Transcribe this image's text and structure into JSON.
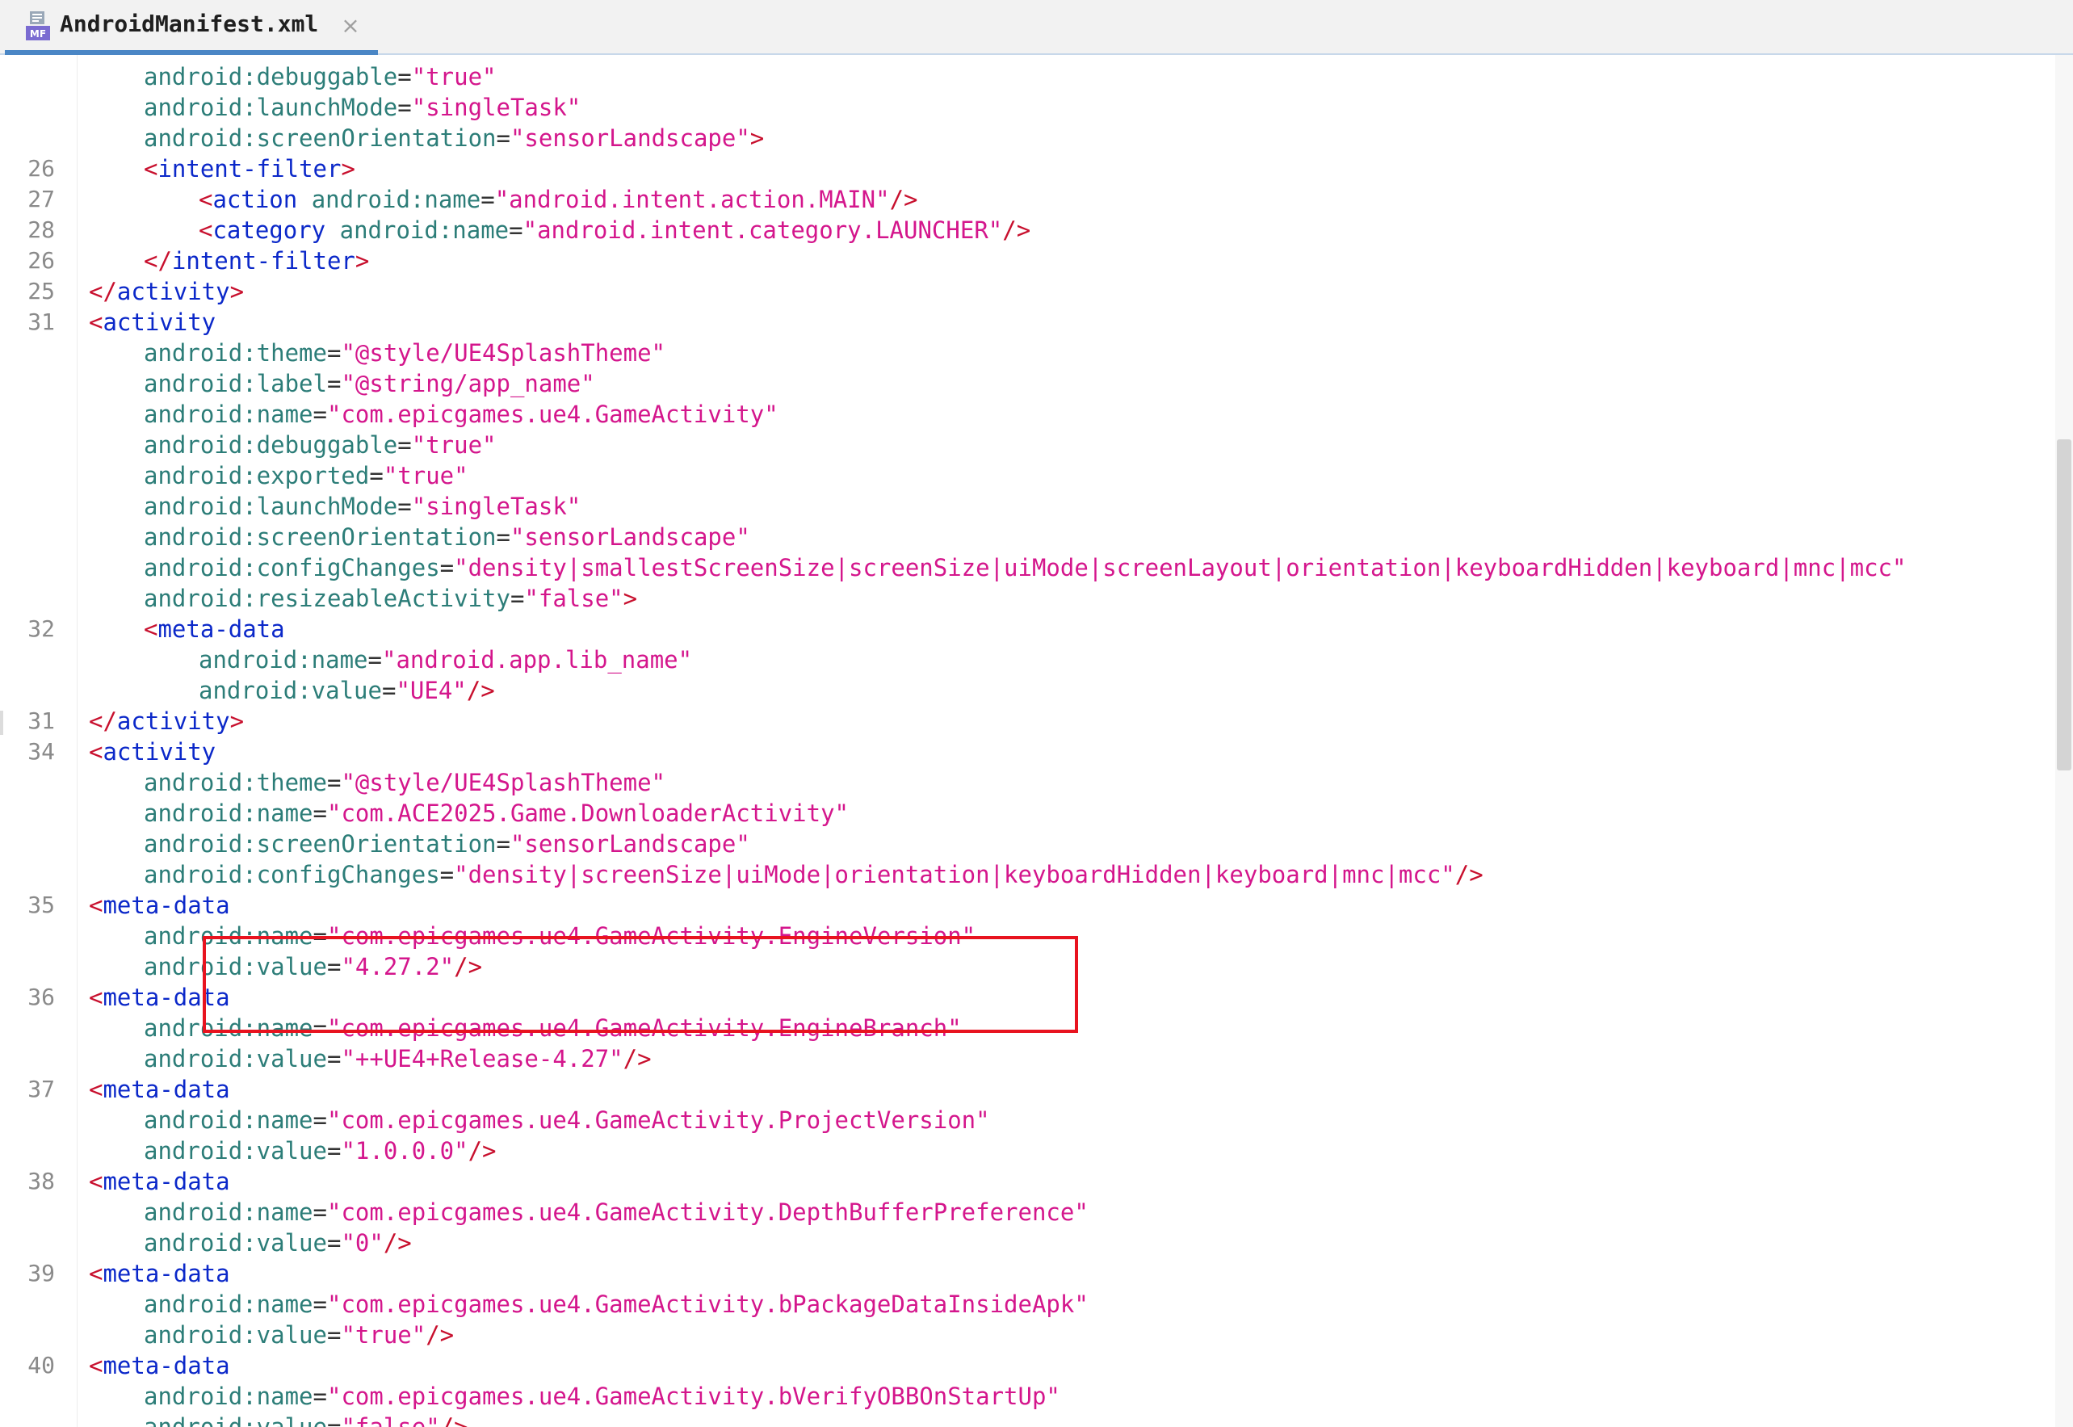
{
  "tab": {
    "title": "AndroidManifest.xml",
    "icon": "manifest-file-icon",
    "icon_label": "MF",
    "close_icon": "close-icon",
    "close_glyph": "×"
  },
  "colors": {
    "tag": "#0b28c9",
    "bracket": "#c8102e",
    "attribute": "#2c7d78",
    "string": "#d4168c",
    "line_number": "#8a8a8a",
    "highlight_border": "#e8131f"
  },
  "editor": {
    "highlighted_block": "meta-data EngineVersion",
    "lines": [
      {
        "num": "",
        "indent": 2,
        "tokens": [
          [
            "a",
            "android:debuggable"
          ],
          [
            "e",
            "="
          ],
          [
            "s",
            "\"true\""
          ]
        ]
      },
      {
        "num": "",
        "indent": 2,
        "tokens": [
          [
            "a",
            "android:launchMode"
          ],
          [
            "e",
            "="
          ],
          [
            "s",
            "\"singleTask\""
          ]
        ]
      },
      {
        "num": "",
        "indent": 2,
        "tokens": [
          [
            "a",
            "android:screenOrientation"
          ],
          [
            "e",
            "="
          ],
          [
            "s",
            "\"sensorLandscape\""
          ],
          [
            "b",
            ">"
          ]
        ]
      },
      {
        "num": "26",
        "indent": 2,
        "tokens": [
          [
            "b",
            "<"
          ],
          [
            "t",
            "intent-filter"
          ],
          [
            "b",
            ">"
          ]
        ]
      },
      {
        "num": "27",
        "indent": 3,
        "tokens": [
          [
            "b",
            "<"
          ],
          [
            "t",
            "action"
          ],
          [
            "e",
            " "
          ],
          [
            "a",
            "android:name"
          ],
          [
            "e",
            "="
          ],
          [
            "s",
            "\"android.intent.action.MAIN\""
          ],
          [
            "b",
            "/>"
          ]
        ]
      },
      {
        "num": "28",
        "indent": 3,
        "tokens": [
          [
            "b",
            "<"
          ],
          [
            "t",
            "category"
          ],
          [
            "e",
            " "
          ],
          [
            "a",
            "android:name"
          ],
          [
            "e",
            "="
          ],
          [
            "s",
            "\"android.intent.category.LAUNCHER\""
          ],
          [
            "b",
            "/>"
          ]
        ]
      },
      {
        "num": "26",
        "indent": 2,
        "tokens": [
          [
            "b",
            "</"
          ],
          [
            "t",
            "intent-filter"
          ],
          [
            "b",
            ">"
          ]
        ]
      },
      {
        "num": "25",
        "indent": 1,
        "tokens": [
          [
            "b",
            "</"
          ],
          [
            "t",
            "activity"
          ],
          [
            "b",
            ">"
          ]
        ]
      },
      {
        "num": "31",
        "indent": 1,
        "tokens": [
          [
            "b",
            "<"
          ],
          [
            "t",
            "activity"
          ]
        ]
      },
      {
        "num": "",
        "indent": 2,
        "tokens": [
          [
            "a",
            "android:theme"
          ],
          [
            "e",
            "="
          ],
          [
            "s",
            "\"@style/UE4SplashTheme\""
          ]
        ]
      },
      {
        "num": "",
        "indent": 2,
        "tokens": [
          [
            "a",
            "android:label"
          ],
          [
            "e",
            "="
          ],
          [
            "s",
            "\"@string/app_name\""
          ]
        ]
      },
      {
        "num": "",
        "indent": 2,
        "tokens": [
          [
            "a",
            "android:name"
          ],
          [
            "e",
            "="
          ],
          [
            "s",
            "\"com.epicgames.ue4.GameActivity\""
          ]
        ]
      },
      {
        "num": "",
        "indent": 2,
        "tokens": [
          [
            "a",
            "android:debuggable"
          ],
          [
            "e",
            "="
          ],
          [
            "s",
            "\"true\""
          ]
        ]
      },
      {
        "num": "",
        "indent": 2,
        "tokens": [
          [
            "a",
            "android:exported"
          ],
          [
            "e",
            "="
          ],
          [
            "s",
            "\"true\""
          ]
        ]
      },
      {
        "num": "",
        "indent": 2,
        "tokens": [
          [
            "a",
            "android:launchMode"
          ],
          [
            "e",
            "="
          ],
          [
            "s",
            "\"singleTask\""
          ]
        ]
      },
      {
        "num": "",
        "indent": 2,
        "tokens": [
          [
            "a",
            "android:screenOrientation"
          ],
          [
            "e",
            "="
          ],
          [
            "s",
            "\"sensorLandscape\""
          ]
        ]
      },
      {
        "num": "",
        "indent": 2,
        "tokens": [
          [
            "a",
            "android:configChanges"
          ],
          [
            "e",
            "="
          ],
          [
            "s",
            "\"density|smallestScreenSize|screenSize|uiMode|screenLayout|orientation|keyboardHidden|keyboard|mnc|mcc\""
          ]
        ]
      },
      {
        "num": "",
        "indent": 2,
        "tokens": [
          [
            "a",
            "android:resizeableActivity"
          ],
          [
            "e",
            "="
          ],
          [
            "s",
            "\"false\""
          ],
          [
            "b",
            ">"
          ]
        ]
      },
      {
        "num": "32",
        "indent": 2,
        "tokens": [
          [
            "b",
            "<"
          ],
          [
            "t",
            "meta-data"
          ]
        ]
      },
      {
        "num": "",
        "indent": 3,
        "tokens": [
          [
            "a",
            "android:name"
          ],
          [
            "e",
            "="
          ],
          [
            "s",
            "\"android.app.lib_name\""
          ]
        ]
      },
      {
        "num": "",
        "indent": 3,
        "tokens": [
          [
            "a",
            "android:value"
          ],
          [
            "e",
            "="
          ],
          [
            "s",
            "\"UE4\""
          ],
          [
            "b",
            "/>"
          ]
        ]
      },
      {
        "num": "31",
        "indent": 1,
        "tokens": [
          [
            "b",
            "</"
          ],
          [
            "t",
            "activity"
          ],
          [
            "b",
            ">"
          ]
        ]
      },
      {
        "num": "34",
        "indent": 1,
        "tokens": [
          [
            "b",
            "<"
          ],
          [
            "t",
            "activity"
          ]
        ]
      },
      {
        "num": "",
        "indent": 2,
        "tokens": [
          [
            "a",
            "android:theme"
          ],
          [
            "e",
            "="
          ],
          [
            "s",
            "\"@style/UE4SplashTheme\""
          ]
        ]
      },
      {
        "num": "",
        "indent": 2,
        "tokens": [
          [
            "a",
            "android:name"
          ],
          [
            "e",
            "="
          ],
          [
            "s",
            "\"com.ACE2025.Game.DownloaderActivity\""
          ]
        ]
      },
      {
        "num": "",
        "indent": 2,
        "tokens": [
          [
            "a",
            "android:screenOrientation"
          ],
          [
            "e",
            "="
          ],
          [
            "s",
            "\"sensorLandscape\""
          ]
        ]
      },
      {
        "num": "",
        "indent": 2,
        "tokens": [
          [
            "a",
            "android:configChanges"
          ],
          [
            "e",
            "="
          ],
          [
            "s",
            "\"density|screenSize|uiMode|orientation|keyboardHidden|keyboard|mnc|mcc\""
          ],
          [
            "b",
            "/>"
          ]
        ]
      },
      {
        "num": "35",
        "indent": 1,
        "tokens": [
          [
            "b",
            "<"
          ],
          [
            "t",
            "meta-data"
          ]
        ]
      },
      {
        "num": "",
        "indent": 2,
        "tokens": [
          [
            "a",
            "android:name"
          ],
          [
            "e",
            "="
          ],
          [
            "s",
            "\"com.epicgames.ue4.GameActivity.EngineVersion\""
          ]
        ]
      },
      {
        "num": "",
        "indent": 2,
        "tokens": [
          [
            "a",
            "android:value"
          ],
          [
            "e",
            "="
          ],
          [
            "s",
            "\"4.27.2\""
          ],
          [
            "b",
            "/>"
          ]
        ]
      },
      {
        "num": "36",
        "indent": 1,
        "tokens": [
          [
            "b",
            "<"
          ],
          [
            "t",
            "meta-data"
          ]
        ]
      },
      {
        "num": "",
        "indent": 2,
        "tokens": [
          [
            "a",
            "android:name"
          ],
          [
            "e",
            "="
          ],
          [
            "s",
            "\"com.epicgames.ue4.GameActivity.EngineBranch\""
          ]
        ]
      },
      {
        "num": "",
        "indent": 2,
        "tokens": [
          [
            "a",
            "android:value"
          ],
          [
            "e",
            "="
          ],
          [
            "s",
            "\"++UE4+Release-4.27\""
          ],
          [
            "b",
            "/>"
          ]
        ]
      },
      {
        "num": "37",
        "indent": 1,
        "tokens": [
          [
            "b",
            "<"
          ],
          [
            "t",
            "meta-data"
          ]
        ]
      },
      {
        "num": "",
        "indent": 2,
        "tokens": [
          [
            "a",
            "android:name"
          ],
          [
            "e",
            "="
          ],
          [
            "s",
            "\"com.epicgames.ue4.GameActivity.ProjectVersion\""
          ]
        ]
      },
      {
        "num": "",
        "indent": 2,
        "tokens": [
          [
            "a",
            "android:value"
          ],
          [
            "e",
            "="
          ],
          [
            "s",
            "\"1.0.0.0\""
          ],
          [
            "b",
            "/>"
          ]
        ]
      },
      {
        "num": "38",
        "indent": 1,
        "tokens": [
          [
            "b",
            "<"
          ],
          [
            "t",
            "meta-data"
          ]
        ]
      },
      {
        "num": "",
        "indent": 2,
        "tokens": [
          [
            "a",
            "android:name"
          ],
          [
            "e",
            "="
          ],
          [
            "s",
            "\"com.epicgames.ue4.GameActivity.DepthBufferPreference\""
          ]
        ]
      },
      {
        "num": "",
        "indent": 2,
        "tokens": [
          [
            "a",
            "android:value"
          ],
          [
            "e",
            "="
          ],
          [
            "s",
            "\"0\""
          ],
          [
            "b",
            "/>"
          ]
        ]
      },
      {
        "num": "39",
        "indent": 1,
        "tokens": [
          [
            "b",
            "<"
          ],
          [
            "t",
            "meta-data"
          ]
        ]
      },
      {
        "num": "",
        "indent": 2,
        "tokens": [
          [
            "a",
            "android:name"
          ],
          [
            "e",
            "="
          ],
          [
            "s",
            "\"com.epicgames.ue4.GameActivity.bPackageDataInsideApk\""
          ]
        ]
      },
      {
        "num": "",
        "indent": 2,
        "tokens": [
          [
            "a",
            "android:value"
          ],
          [
            "e",
            "="
          ],
          [
            "s",
            "\"true\""
          ],
          [
            "b",
            "/>"
          ]
        ]
      },
      {
        "num": "40",
        "indent": 1,
        "tokens": [
          [
            "b",
            "<"
          ],
          [
            "t",
            "meta-data"
          ]
        ]
      },
      {
        "num": "",
        "indent": 2,
        "tokens": [
          [
            "a",
            "android:name"
          ],
          [
            "e",
            "="
          ],
          [
            "s",
            "\"com.epicgames.ue4.GameActivity.bVerifyOBBOnStartUp\""
          ]
        ]
      },
      {
        "num": "",
        "indent": 2,
        "tokens": [
          [
            "a",
            "android:value"
          ],
          [
            "e",
            "="
          ],
          [
            "s",
            "\"false\""
          ],
          [
            "b",
            "/>"
          ]
        ]
      }
    ]
  }
}
